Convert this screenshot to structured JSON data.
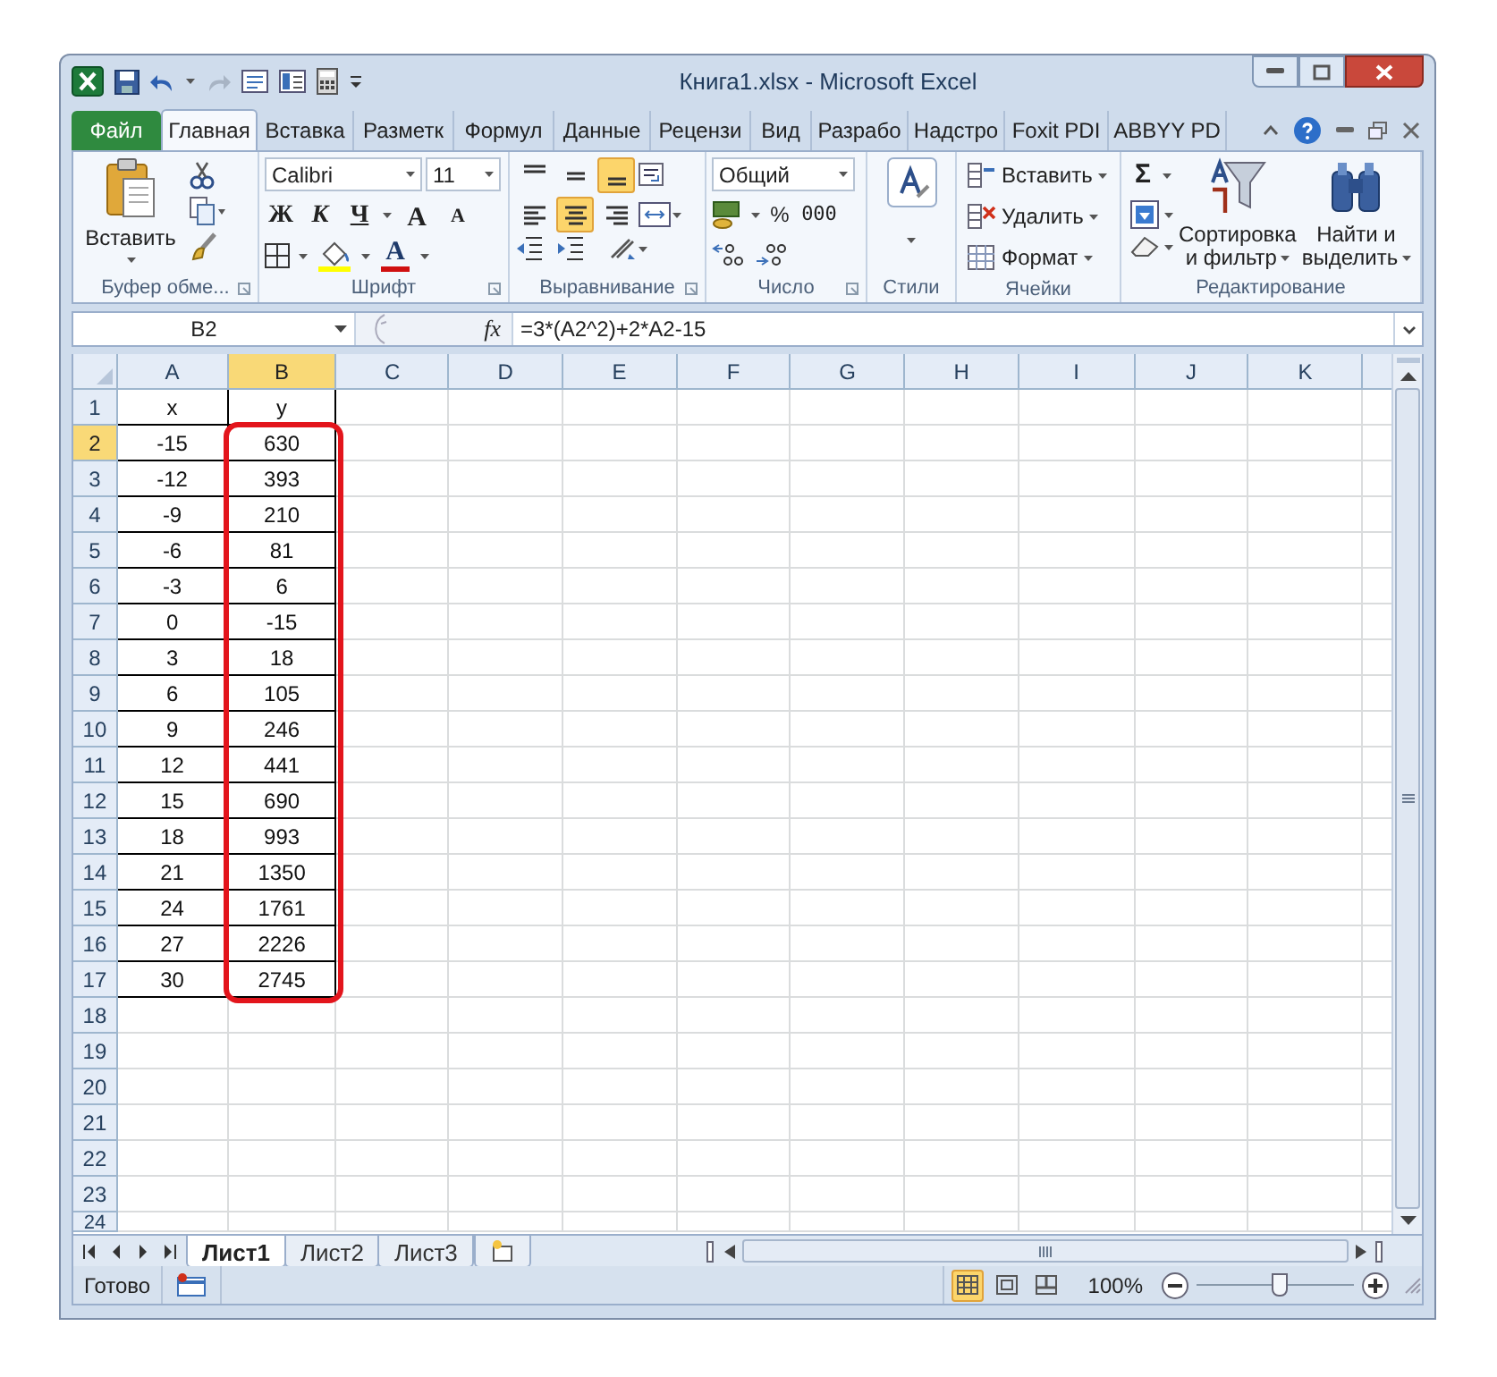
{
  "window": {
    "title": "Книга1.xlsx - Microsoft Excel"
  },
  "ribbon_tabs": [
    {
      "label": "Файл",
      "kind": "file",
      "selected": false
    },
    {
      "label": "Главная",
      "kind": "tab",
      "selected": true
    },
    {
      "label": "Вставка",
      "kind": "tab",
      "selected": false
    },
    {
      "label": "Разметк",
      "kind": "tab",
      "selected": false
    },
    {
      "label": "Формул",
      "kind": "tab",
      "selected": false
    },
    {
      "label": "Данные",
      "kind": "tab",
      "selected": false
    },
    {
      "label": "Рецензи",
      "kind": "tab",
      "selected": false
    },
    {
      "label": "Вид",
      "kind": "tab",
      "selected": false
    },
    {
      "label": "Разрабо",
      "kind": "tab",
      "selected": false
    },
    {
      "label": "Надстро",
      "kind": "tab",
      "selected": false
    },
    {
      "label": "Foxit PDI",
      "kind": "tab",
      "selected": false
    },
    {
      "label": "ABBYY PD",
      "kind": "tab",
      "selected": false
    }
  ],
  "ribbon": {
    "clipboard": {
      "label": "Буфер обме...",
      "paste": "Вставить"
    },
    "font": {
      "label": "Шрифт",
      "font_name": "Calibri",
      "font_size": "11",
      "styles": [
        "Ж",
        "К",
        "Ч"
      ],
      "grow": "A",
      "shrink": "A",
      "font_color": "A"
    },
    "alignment": {
      "label": "Выравнивание",
      "buttons": [
        {
          "kind": "top",
          "selected": false
        },
        {
          "kind": "middle",
          "selected": false
        },
        {
          "kind": "bottom",
          "selected": true
        },
        {
          "kind": "left",
          "selected": false
        },
        {
          "kind": "center",
          "selected": true
        },
        {
          "kind": "right",
          "selected": false
        }
      ]
    },
    "number": {
      "label": "Число",
      "format": "Общий",
      "percent": "%",
      "thousands": "000"
    },
    "styles": {
      "label": "Стили"
    },
    "cells": {
      "label": "Ячейки",
      "buttons": [
        "Вставить",
        "Удалить",
        "Формат"
      ]
    },
    "editing": {
      "label": "Редактирование",
      "autosum": "Σ",
      "sort": [
        "Сортировка",
        "и фильтр"
      ],
      "find": [
        "Найти и",
        "выделить"
      ]
    }
  },
  "formula_bar": {
    "name_box": "B2",
    "fx": "fx",
    "formula": "=3*(A2^2)+2*A2-15"
  },
  "columns": [
    {
      "label": "A",
      "selected": false
    },
    {
      "label": "B",
      "selected": true
    },
    {
      "label": "C",
      "selected": false
    },
    {
      "label": "D",
      "selected": false
    },
    {
      "label": "E",
      "selected": false
    },
    {
      "label": "F",
      "selected": false
    },
    {
      "label": "G",
      "selected": false
    },
    {
      "label": "H",
      "selected": false
    },
    {
      "label": "I",
      "selected": false
    },
    {
      "label": "J",
      "selected": false
    },
    {
      "label": "K",
      "selected": false
    }
  ],
  "rows": [
    {
      "header": "1",
      "selected": false,
      "cells": [
        "x",
        "y"
      ]
    },
    {
      "header": "2",
      "selected": true,
      "cells": [
        "-15",
        "630"
      ]
    },
    {
      "header": "3",
      "selected": false,
      "cells": [
        "-12",
        "393"
      ]
    },
    {
      "header": "4",
      "selected": false,
      "cells": [
        "-9",
        "210"
      ]
    },
    {
      "header": "5",
      "selected": false,
      "cells": [
        "-6",
        "81"
      ]
    },
    {
      "header": "6",
      "selected": false,
      "cells": [
        "-3",
        "6"
      ]
    },
    {
      "header": "7",
      "selected": false,
      "cells": [
        "0",
        "-15"
      ]
    },
    {
      "header": "8",
      "selected": false,
      "cells": [
        "3",
        "18"
      ]
    },
    {
      "header": "9",
      "selected": false,
      "cells": [
        "6",
        "105"
      ]
    },
    {
      "header": "10",
      "selected": false,
      "cells": [
        "9",
        "246"
      ]
    },
    {
      "header": "11",
      "selected": false,
      "cells": [
        "12",
        "441"
      ]
    },
    {
      "header": "12",
      "selected": false,
      "cells": [
        "15",
        "690"
      ]
    },
    {
      "header": "13",
      "selected": false,
      "cells": [
        "18",
        "993"
      ]
    },
    {
      "header": "14",
      "selected": false,
      "cells": [
        "21",
        "1350"
      ]
    },
    {
      "header": "15",
      "selected": false,
      "cells": [
        "24",
        "1761"
      ]
    },
    {
      "header": "16",
      "selected": false,
      "cells": [
        "27",
        "2226"
      ]
    },
    {
      "header": "17",
      "selected": false,
      "cells": [
        "30",
        "2745"
      ]
    },
    {
      "header": "18",
      "selected": false,
      "cells": []
    },
    {
      "header": "19",
      "selected": false,
      "cells": []
    },
    {
      "header": "20",
      "selected": false,
      "cells": []
    },
    {
      "header": "21",
      "selected": false,
      "cells": []
    },
    {
      "header": "22",
      "selected": false,
      "cells": []
    },
    {
      "header": "23",
      "selected": false,
      "cells": []
    },
    {
      "header": "24",
      "selected": false,
      "cells": []
    }
  ],
  "annotation": {
    "kind": "red-outline"
  },
  "sheet_tabs": [
    {
      "label": "Лист1",
      "selected": true
    },
    {
      "label": "Лист2",
      "selected": false
    },
    {
      "label": "Лист3",
      "selected": false
    }
  ],
  "status_bar": {
    "text": "Готово",
    "views": [
      {
        "kind": "normal",
        "selected": true
      },
      {
        "kind": "page-layout",
        "selected": false
      },
      {
        "kind": "page-break",
        "selected": false
      }
    ],
    "zoom": "100%",
    "level": 0.52
  }
}
